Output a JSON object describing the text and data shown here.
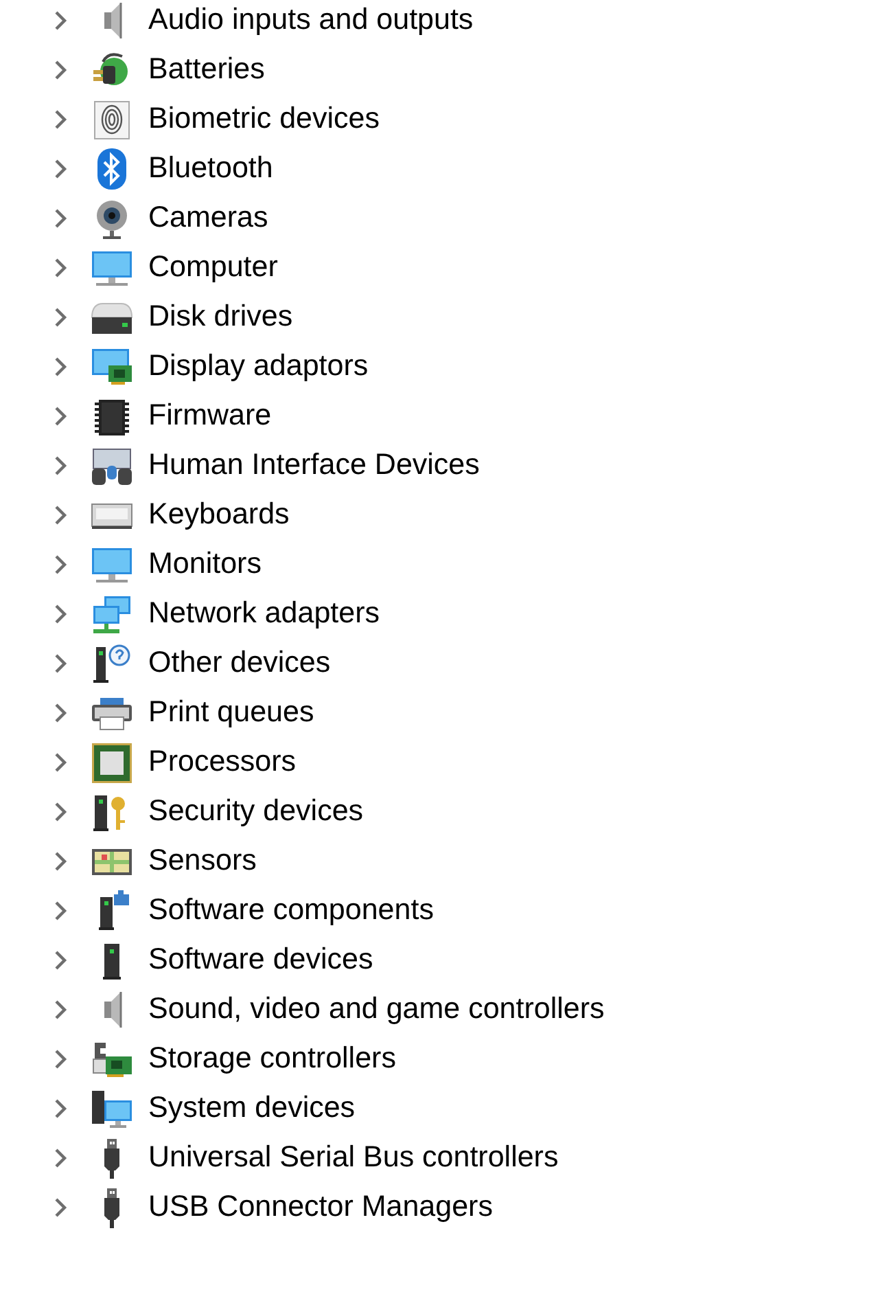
{
  "tree": {
    "items": [
      {
        "label": "Audio inputs and outputs",
        "kind": "speaker",
        "expanded": false
      },
      {
        "label": "Batteries",
        "kind": "battery",
        "expanded": false
      },
      {
        "label": "Biometric devices",
        "kind": "fingerprint",
        "expanded": false
      },
      {
        "label": "Bluetooth",
        "kind": "bluetooth",
        "expanded": false
      },
      {
        "label": "Cameras",
        "kind": "camera",
        "expanded": false
      },
      {
        "label": "Computer",
        "kind": "monitor",
        "expanded": false
      },
      {
        "label": "Disk drives",
        "kind": "disk",
        "expanded": false
      },
      {
        "label": "Display adaptors",
        "kind": "display-adapter",
        "expanded": false
      },
      {
        "label": "Firmware",
        "kind": "chip",
        "expanded": false
      },
      {
        "label": "Human Interface Devices",
        "kind": "hid",
        "expanded": false
      },
      {
        "label": "Keyboards",
        "kind": "keyboard",
        "expanded": false
      },
      {
        "label": "Monitors",
        "kind": "monitor",
        "expanded": false
      },
      {
        "label": "Network adapters",
        "kind": "network",
        "expanded": false
      },
      {
        "label": "Other devices",
        "kind": "unknown",
        "expanded": false
      },
      {
        "label": "Print queues",
        "kind": "printer",
        "expanded": false
      },
      {
        "label": "Processors",
        "kind": "processor",
        "expanded": false
      },
      {
        "label": "Security devices",
        "kind": "security",
        "expanded": false
      },
      {
        "label": "Sensors",
        "kind": "sensor",
        "expanded": false
      },
      {
        "label": "Software components",
        "kind": "component",
        "expanded": false
      },
      {
        "label": "Software devices",
        "kind": "tower",
        "expanded": false
      },
      {
        "label": "Sound, video and game controllers",
        "kind": "speaker",
        "expanded": false
      },
      {
        "label": "Storage controllers",
        "kind": "storage",
        "expanded": false
      },
      {
        "label": "System devices",
        "kind": "system",
        "expanded": false
      },
      {
        "label": "Universal Serial Bus controllers",
        "kind": "usb",
        "expanded": false
      },
      {
        "label": "USB Connector Managers",
        "kind": "usb",
        "expanded": false
      }
    ]
  }
}
